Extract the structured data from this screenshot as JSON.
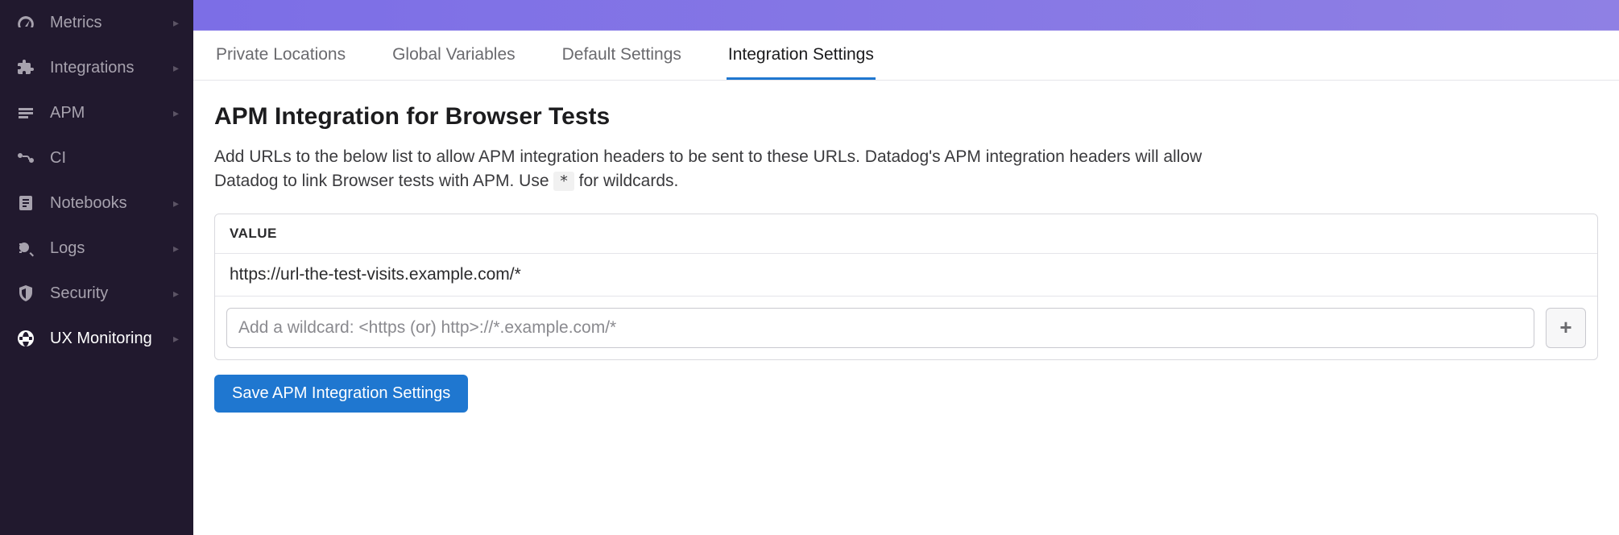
{
  "sidebar": {
    "items": [
      {
        "label": "Metrics",
        "icon": "gauge-icon",
        "has_submenu": true,
        "active": false
      },
      {
        "label": "Integrations",
        "icon": "puzzle-icon",
        "has_submenu": true,
        "active": false
      },
      {
        "label": "APM",
        "icon": "layers-icon",
        "has_submenu": true,
        "active": false
      },
      {
        "label": "CI",
        "icon": "pipeline-icon",
        "has_submenu": false,
        "active": false
      },
      {
        "label": "Notebooks",
        "icon": "notebook-icon",
        "has_submenu": true,
        "active": false
      },
      {
        "label": "Logs",
        "icon": "logs-icon",
        "has_submenu": true,
        "active": false
      },
      {
        "label": "Security",
        "icon": "shield-icon",
        "has_submenu": true,
        "active": false
      },
      {
        "label": "UX Monitoring",
        "icon": "globe-icon",
        "has_submenu": true,
        "active": true
      }
    ]
  },
  "tabs": [
    {
      "label": "Private Locations",
      "active": false
    },
    {
      "label": "Global Variables",
      "active": false
    },
    {
      "label": "Default Settings",
      "active": false
    },
    {
      "label": "Integration Settings",
      "active": true
    }
  ],
  "page": {
    "title": "APM Integration for Browser Tests",
    "desc_pre": "Add URLs to the below list to allow APM integration headers to be sent to these URLs. Datadog's APM integration headers will allow Datadog to link Browser tests with APM. Use ",
    "desc_code": "*",
    "desc_post": " for wildcards."
  },
  "value_table": {
    "header": "VALUE",
    "rows": [
      "https://url-the-test-visits.example.com/*"
    ],
    "input_placeholder": "Add a wildcard: <https (or) http>://*.example.com/*",
    "add_glyph": "+"
  },
  "save_button_label": "Save APM Integration Settings"
}
